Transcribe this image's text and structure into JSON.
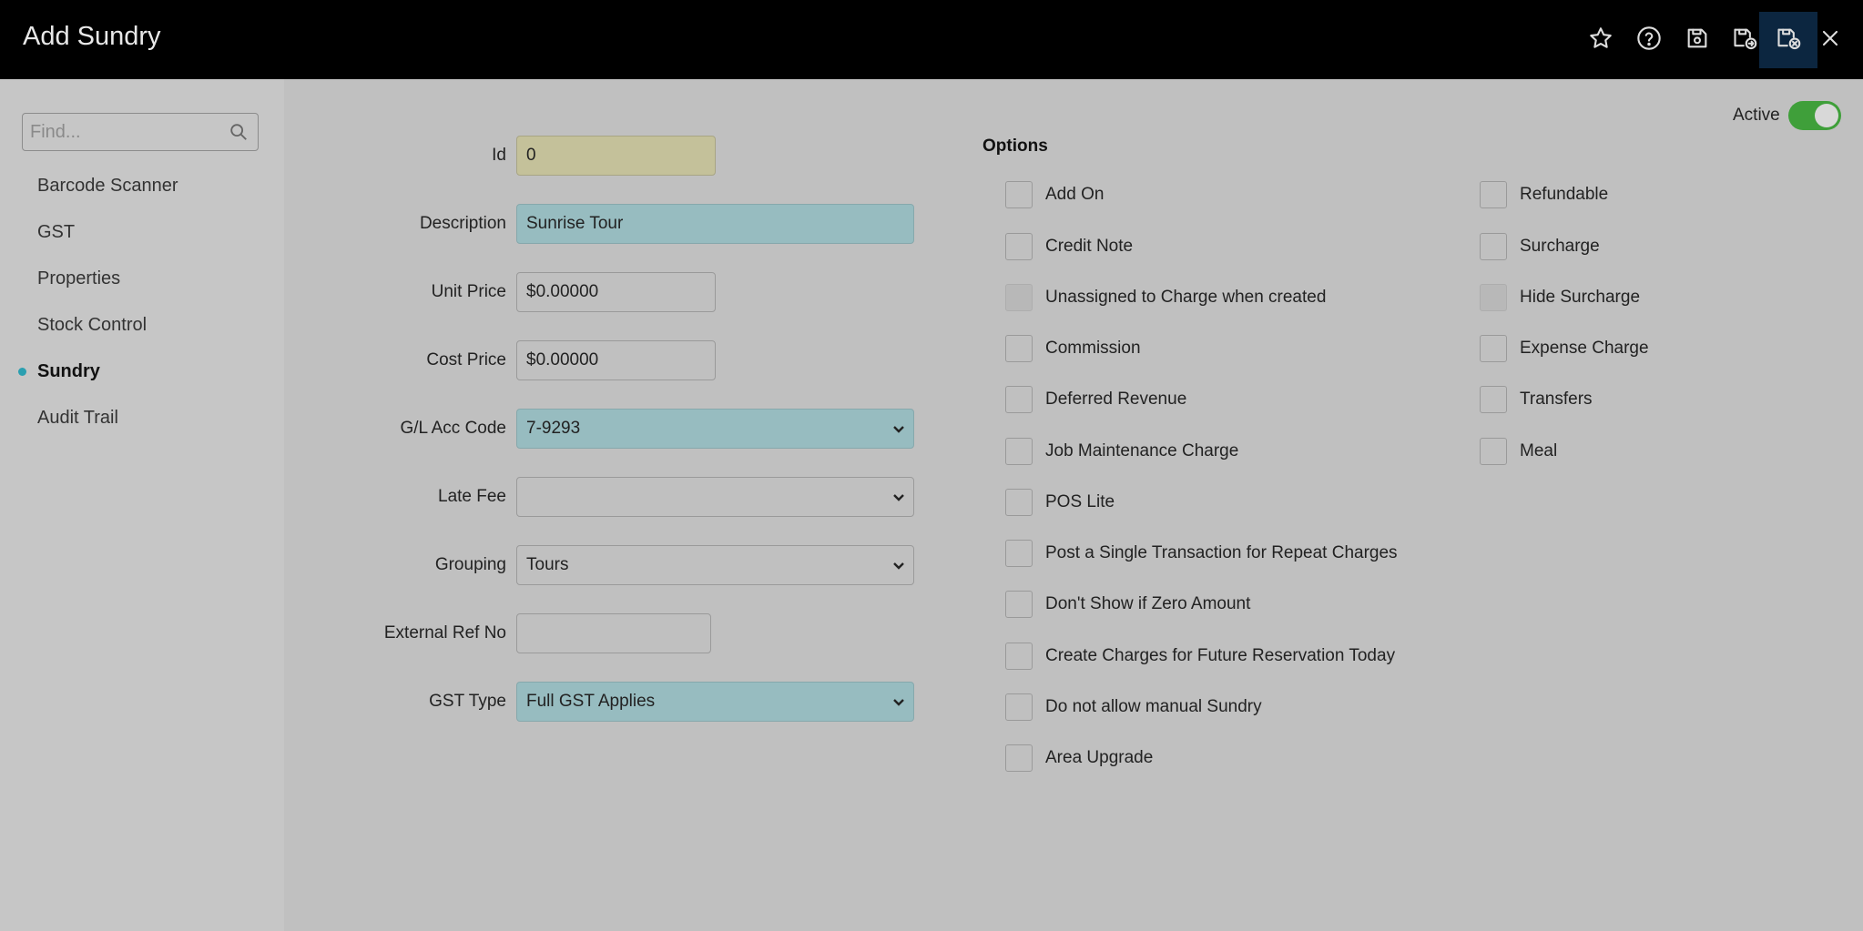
{
  "window": {
    "title": "Add Sundry"
  },
  "toolbar": {
    "icons": [
      "star-icon",
      "help-icon",
      "save-icon",
      "save-and-new-icon",
      "save-and-close-icon",
      "close-icon"
    ]
  },
  "sidebar": {
    "search_placeholder": "Find...",
    "items": [
      {
        "label": "Barcode Scanner"
      },
      {
        "label": "GST"
      },
      {
        "label": "Properties"
      },
      {
        "label": "Stock Control"
      },
      {
        "label": "Sundry",
        "selected": true
      },
      {
        "label": "Audit Trail"
      }
    ]
  },
  "form": {
    "id": {
      "label": "Id",
      "value": "0"
    },
    "description": {
      "label": "Description",
      "value": "Sunrise Tour"
    },
    "unit_price": {
      "label": "Unit Price",
      "value": "$0.00000"
    },
    "cost_price": {
      "label": "Cost Price",
      "value": "$0.00000"
    },
    "gl_acc_code": {
      "label": "G/L Acc Code",
      "value": "7-9293"
    },
    "late_fee": {
      "label": "Late Fee",
      "value": ""
    },
    "grouping": {
      "label": "Grouping",
      "value": "Tours"
    },
    "external_ref": {
      "label": "External Ref No",
      "value": ""
    },
    "gst_type": {
      "label": "GST Type",
      "value": "Full GST Applies"
    }
  },
  "active": {
    "label": "Active",
    "on": true
  },
  "options": {
    "title": "Options",
    "left": [
      {
        "label": "Add On",
        "checked": false,
        "disabled": false
      },
      {
        "label": "Credit Note",
        "checked": false,
        "disabled": false
      },
      {
        "label": "Unassigned to Charge when created",
        "checked": false,
        "disabled": true
      },
      {
        "label": "Commission",
        "checked": false,
        "disabled": false
      },
      {
        "label": "Deferred Revenue",
        "checked": false,
        "disabled": false
      },
      {
        "label": "Job Maintenance Charge",
        "checked": false,
        "disabled": false
      },
      {
        "label": "POS Lite",
        "checked": false,
        "disabled": false
      },
      {
        "label": "Post a Single Transaction for Repeat Charges",
        "checked": false,
        "disabled": false
      },
      {
        "label": "Don't Show if Zero Amount",
        "checked": false,
        "disabled": false
      },
      {
        "label": "Create Charges for Future Reservation Today",
        "checked": false,
        "disabled": false
      },
      {
        "label": "Do not allow manual Sundry",
        "checked": false,
        "disabled": false
      },
      {
        "label": "Area Upgrade",
        "checked": false,
        "disabled": false
      }
    ],
    "right": [
      {
        "label": "Refundable",
        "checked": false,
        "disabled": false
      },
      {
        "label": "Surcharge",
        "checked": false,
        "disabled": false
      },
      {
        "label": "Hide Surcharge",
        "checked": false,
        "disabled": true
      },
      {
        "label": "Expense Charge",
        "checked": false,
        "disabled": false
      },
      {
        "label": "Transfers",
        "checked": false,
        "disabled": false
      },
      {
        "label": "Meal",
        "checked": false,
        "disabled": false
      }
    ]
  },
  "colors": {
    "topbar": "#000000",
    "accent_teal": "#97bcc0",
    "id_field": "#c4c19a",
    "toggle_on": "#3f9f3a",
    "nav_dot": "#2a9fb0"
  }
}
